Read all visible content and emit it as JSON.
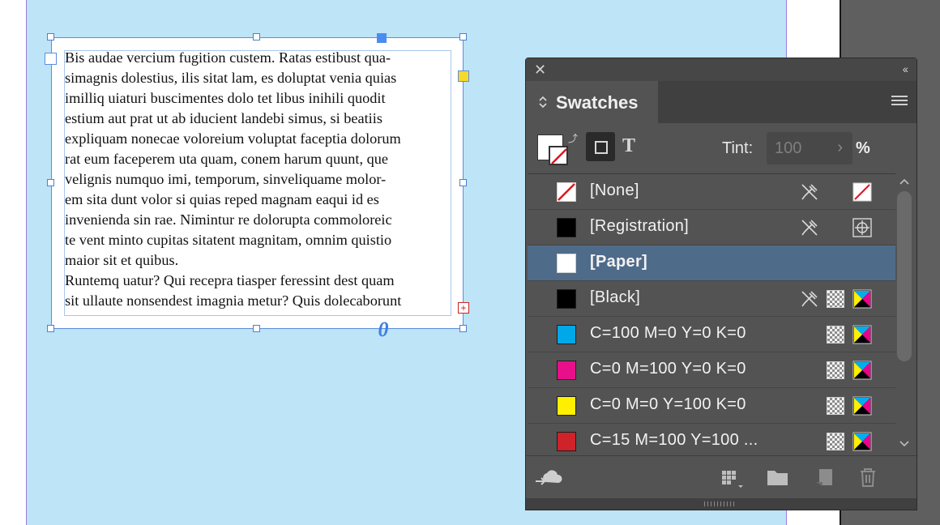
{
  "document": {
    "text_lines": [
      "Bis audae vercium fugition custem. Ratas estibust qua-",
      "simagnis dolestius, ilis sitat lam, es doluptat venia quias",
      "imilliq uiaturi buscimentes dolo tet libus inihili quodit",
      "estium aut prat ut ab iducient landebi simus, si beatiis",
      "expliquam nonecae voloreium voluptat faceptia dolorum",
      "rat eum faceperem uta quam, conem harum quunt, que",
      "velignis numquo imi, temporum, sinveliquame molor-",
      "em sita dunt volor si quias reped magnam eaqui id es",
      "invenienda sin rae. Nimintur re dolorupta commoloreic",
      "te vent minto cupitas sitatent magnitam, omnim quistio",
      "maior sit et quibus.",
      "Runtemq uatur? Qui recepra tiasper feressint dest quam",
      "sit ullaute nonsendest imagnia metur? Quis dolecaborunt"
    ],
    "overset_marker": "+",
    "frame_type_glyph": "0"
  },
  "panel": {
    "close_glyph": "✕",
    "collapse_glyph": "‹‹",
    "tab_label": "Swatches",
    "tab_chevron": "⌃⌄",
    "tint_label": "Tint:",
    "tint_value": "100",
    "tint_arrow": "›",
    "tint_unit": "%",
    "text_toggle_glyph": "T",
    "swap_glyph": "⤴",
    "swatches": [
      {
        "name": "[None]",
        "color": "none",
        "locked": true,
        "mode": "none",
        "type": "none"
      },
      {
        "name": "[Registration]",
        "color": "#000000",
        "locked": true,
        "mode": "registration",
        "type": null
      },
      {
        "name": "[Paper]",
        "color": "#ffffff",
        "locked": false,
        "mode": null,
        "type": null,
        "selected": true
      },
      {
        "name": "[Black]",
        "color": "#000000",
        "locked": true,
        "mode": "process",
        "type": "cmyk"
      },
      {
        "name": "C=100 M=0 Y=0 K=0",
        "color": "#00a8e8",
        "locked": false,
        "mode": "process",
        "type": "cmyk"
      },
      {
        "name": "C=0 M=100 Y=0 K=0",
        "color": "#e8108a",
        "locked": false,
        "mode": "process",
        "type": "cmyk"
      },
      {
        "name": "C=0 M=0 Y=100 K=0",
        "color": "#ffef00",
        "locked": false,
        "mode": "process",
        "type": "cmyk"
      },
      {
        "name": "C=15 M=100 Y=100 ...",
        "color": "#cf2229",
        "locked": false,
        "mode": "process",
        "type": "cmyk"
      }
    ],
    "scroll_up_glyph": "⌃",
    "scroll_down_glyph": "⌄",
    "bottom_icons": [
      "cloud-library-icon",
      "swatch-views-icon",
      "new-color-group-icon",
      "new-swatch-icon",
      "delete-swatch-icon"
    ]
  },
  "colors": {
    "page_bg": "#bde4f7",
    "selection_blue": "#4a8df0",
    "panel_bg": "#535353",
    "selected_row": "#4f6b8a"
  }
}
